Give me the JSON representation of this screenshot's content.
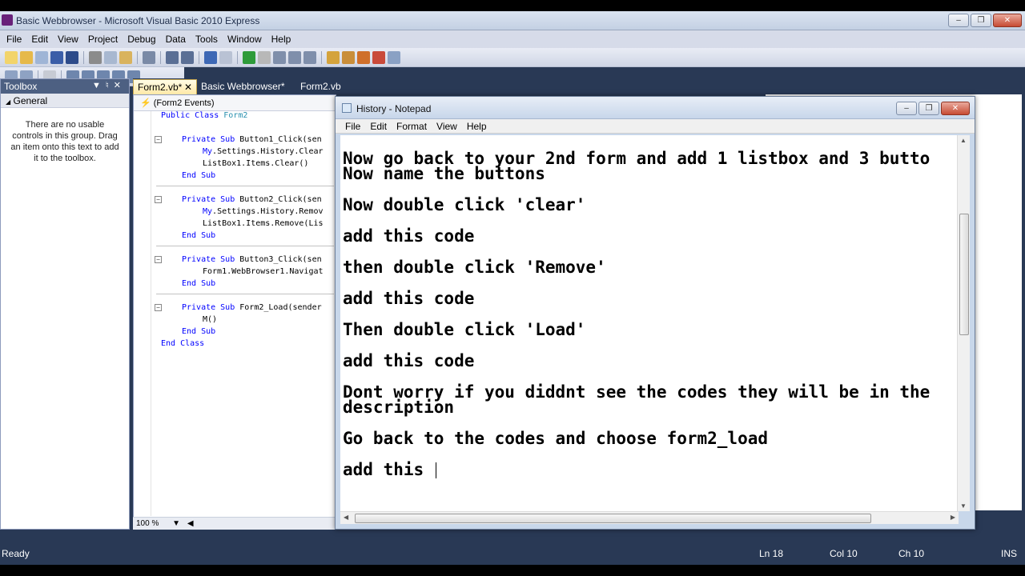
{
  "vs": {
    "title": "Basic Webbrowser - Microsoft Visual Basic 2010 Express",
    "menu": [
      "File",
      "Edit",
      "View",
      "Project",
      "Debug",
      "Data",
      "Tools",
      "Window",
      "Help"
    ]
  },
  "toolbox": {
    "title": "Toolbox",
    "group": "General",
    "message": "There are no usable controls in this group. Drag an item onto this text to add it to the toolbox."
  },
  "tabs": [
    "Form2.vb*",
    "Basic Webbrowser*",
    "Form2.vb"
  ],
  "editor": {
    "events_dropdown": "(Form2 Events)",
    "zoom": "100 %",
    "lines": [
      {
        "kw": "Public Class",
        "rest": " Form2"
      },
      {
        "kw": "Private Sub",
        "rest": " Button1_Click(sen"
      },
      {
        "kw": "",
        "rest": "My.Settings.History.Clear"
      },
      {
        "kw": "",
        "rest": "ListBox1.Items.Clear()"
      },
      {
        "kw": "End Sub",
        "rest": ""
      },
      {
        "kw": "Private Sub",
        "rest": " Button2_Click(sen"
      },
      {
        "kw": "",
        "rest": "My.Settings.History.Remov"
      },
      {
        "kw": "",
        "rest": "ListBox1.Items.Remove(Lis"
      },
      {
        "kw": "End Sub",
        "rest": ""
      },
      {
        "kw": "Private Sub",
        "rest": " Button3_Click(sen"
      },
      {
        "kw": "",
        "rest": "Form1.WebBrowser1.Navigat"
      },
      {
        "kw": "End Sub",
        "rest": ""
      },
      {
        "kw": "Private Sub",
        "rest": " Form2_Load(sender"
      },
      {
        "kw": "",
        "rest": "M()"
      },
      {
        "kw": "End Sub",
        "rest": ""
      },
      {
        "kw": "End Class",
        "rest": ""
      }
    ]
  },
  "notepad": {
    "title": "History - Notepad",
    "menu": [
      "File",
      "Edit",
      "Format",
      "View",
      "Help"
    ],
    "text_lines": [
      "Now go back to your 2nd form and add 1 listbox and 3 butto",
      "Now name the buttons",
      "",
      "Now double click 'clear'",
      "",
      "add this code",
      "",
      "then double click 'Remove'",
      "",
      "add this code",
      "",
      "Then double click 'Load'",
      "",
      "add this code",
      "",
      "Dont worry if you diddnt see the codes they will be in the",
      "description",
      "",
      "Go back to the codes and choose form2_load",
      "",
      "add this "
    ]
  },
  "status": {
    "left": "Ready",
    "ln": "Ln 18",
    "col": "Col 10",
    "ch": "Ch 10",
    "mode": "INS"
  },
  "colors": {
    "chrome_dark": "#293955",
    "keyword": "#0000ff",
    "type": "#2b91af"
  }
}
